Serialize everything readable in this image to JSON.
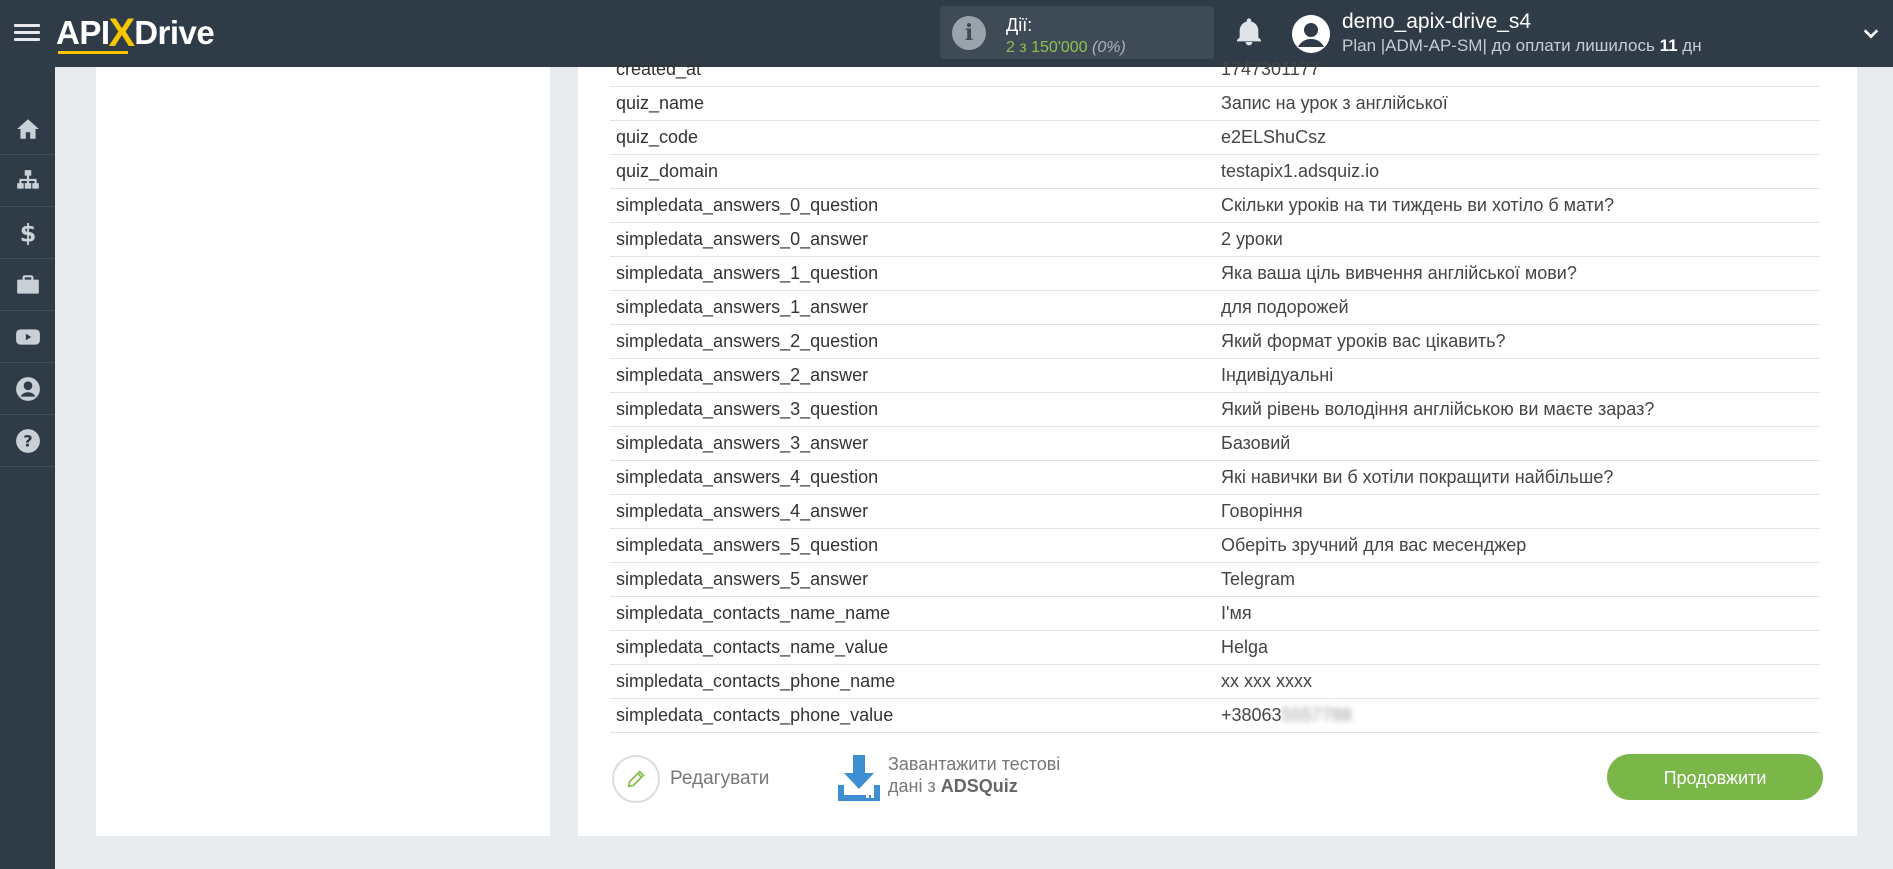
{
  "header": {
    "logo": {
      "left": "API",
      "x": "X",
      "right": "Drive"
    },
    "actions": {
      "title": "Дії:",
      "count": "2 з 150'000",
      "percent": "(0%)"
    },
    "user": {
      "name": "demo_apix-drive_s4",
      "plan_prefix": "Plan |ADM-AP-SM| до оплати лишилось",
      "days": "11",
      "days_unit": "дн"
    }
  },
  "sidebar": {
    "items": [
      {
        "name": "home-icon"
      },
      {
        "name": "sitemap-icon"
      },
      {
        "name": "dollar-icon"
      },
      {
        "name": "briefcase-icon"
      },
      {
        "name": "youtube-icon"
      },
      {
        "name": "user-icon"
      },
      {
        "name": "help-icon"
      }
    ]
  },
  "table": {
    "rows": [
      {
        "key": "created_at",
        "value": "1747301177"
      },
      {
        "key": "quiz_name",
        "value": "Запис на урок з англійської"
      },
      {
        "key": "quiz_code",
        "value": "e2ELShuCsz"
      },
      {
        "key": "quiz_domain",
        "value": "testapix1.adsquiz.io"
      },
      {
        "key": "simpledata_answers_0_question",
        "value": "Скільки уроків на ти тиждень ви хотіло б мати?"
      },
      {
        "key": "simpledata_answers_0_answer",
        "value": "2 уроки"
      },
      {
        "key": "simpledata_answers_1_question",
        "value": "Яка ваша ціль вивчення англійської мови?"
      },
      {
        "key": "simpledata_answers_1_answer",
        "value": "для подорожей"
      },
      {
        "key": "simpledata_answers_2_question",
        "value": "Який формат уроків вас цікавить?"
      },
      {
        "key": "simpledata_answers_2_answer",
        "value": "Індивідуальні"
      },
      {
        "key": "simpledata_answers_3_question",
        "value": "Який рівень володіння англійською ви маєте зараз?"
      },
      {
        "key": "simpledata_answers_3_answer",
        "value": "Базовий"
      },
      {
        "key": "simpledata_answers_4_question",
        "value": "Які навички ви б хотіли покращити найбільше?"
      },
      {
        "key": "simpledata_answers_4_answer",
        "value": "Говоріння"
      },
      {
        "key": "simpledata_answers_5_question",
        "value": "Оберіть зручний для вас месенджер"
      },
      {
        "key": "simpledata_answers_5_answer",
        "value": "Telegram"
      },
      {
        "key": "simpledata_contacts_name_name",
        "value": "І'мя"
      },
      {
        "key": "simpledata_contacts_name_value",
        "value": "Helga"
      },
      {
        "key": "simpledata_contacts_phone_name",
        "value": "xx xxx xxxx"
      },
      {
        "key": "simpledata_contacts_phone_value",
        "value": "+38063",
        "value_blurred": "5557788"
      }
    ]
  },
  "actions_bar": {
    "edit_label": "Редагувати",
    "download_line1": "Завантажити тестові",
    "download_line2_prefix": "дані з",
    "download_source": "ADSQuiz",
    "continue_label": "Продовжити"
  },
  "colors": {
    "topbar": "#2f3c48",
    "accent_green": "#7ab648",
    "logo_yellow": "#f6c500",
    "download_blue": "#3d8fd1"
  }
}
